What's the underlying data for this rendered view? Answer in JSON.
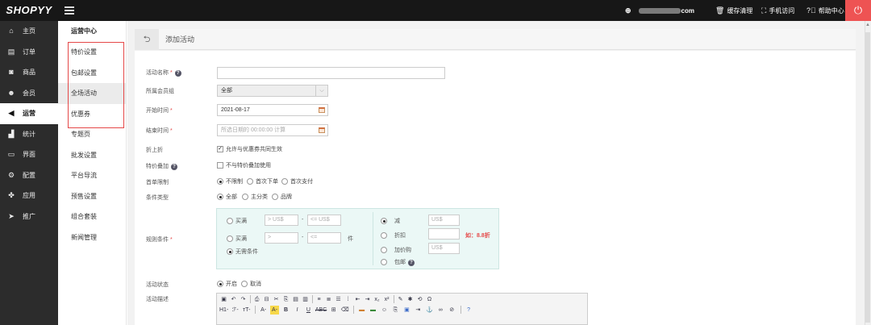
{
  "topbar": {
    "logo": "SHOPYY",
    "domain": "com",
    "cache_clear": "缓存清理",
    "mobile_visit": "手机访问",
    "help_center": "帮助中心",
    "icons": [
      "globe-icon",
      "trash-icon",
      "qr-icon",
      "help-icon",
      "power-icon"
    ]
  },
  "sidebar": {
    "items": [
      {
        "label": "主页",
        "icon": "home-icon"
      },
      {
        "label": "订单",
        "icon": "order-icon"
      },
      {
        "label": "商品",
        "icon": "box-icon"
      },
      {
        "label": "会员",
        "icon": "users-icon"
      },
      {
        "label": "运营",
        "icon": "megaphone-icon",
        "active": true
      },
      {
        "label": "统计",
        "icon": "chart-icon"
      },
      {
        "label": "界面",
        "icon": "window-icon"
      },
      {
        "label": "配置",
        "icon": "gear-icon"
      },
      {
        "label": "应用",
        "icon": "puzzle-icon"
      },
      {
        "label": "推广",
        "icon": "send-icon"
      }
    ]
  },
  "submenu": {
    "title": "运营中心",
    "items": [
      {
        "label": "特价设置"
      },
      {
        "label": "包邮设置"
      },
      {
        "label": "全场活动",
        "active": true
      },
      {
        "label": "优惠券"
      },
      {
        "label": "专题页"
      },
      {
        "label": "批发设置"
      },
      {
        "label": "平台导流"
      },
      {
        "label": "预售设置"
      },
      {
        "label": "组合套装"
      },
      {
        "label": "新闻管理"
      }
    ]
  },
  "page": {
    "title": "添加活动"
  },
  "form": {
    "name_label": "活动名称",
    "name_value": "",
    "member_group_label": "所属会员组",
    "member_group_value": "全部",
    "start_label": "开始时间",
    "start_value": "2021-08-17",
    "end_label": "结束时间",
    "end_placeholder": "所选日期的 00:00:00 计算",
    "discount_label": "折上折",
    "discount_option": "允许与优惠券共同生效",
    "special_label": "特价叠加",
    "special_option": "不与特价叠加使用",
    "first_label": "首单限制",
    "first_options": [
      "不限制",
      "首次下单",
      "首次支付"
    ],
    "cond_type_label": "条件类型",
    "cond_type_options": [
      "全部",
      "主分类",
      "品牌"
    ],
    "rule_label": "规则条件",
    "rule": {
      "buy_label_1": "买满",
      "min_placeholder_1": "> US$",
      "dash": "-",
      "max_placeholder_1": "<= US$",
      "buy_label_2": "买满",
      "min_placeholder_2": ">",
      "max_placeholder_2": "<=",
      "unit": "件",
      "no_cond": "无需条件",
      "reduce": "减",
      "reduce_placeholder": "US$",
      "discount": "折扣",
      "discount_hint": "如：8.8折",
      "add_price": "加价购",
      "add_price_placeholder": "US$",
      "free_ship": "包邮"
    },
    "status_label": "活动状态",
    "status_options": [
      "开启",
      "取消"
    ],
    "desc_label": "活动描述",
    "editor_row1": [
      "▣",
      "↶",
      "↷",
      "⎙",
      "⊟",
      "✂",
      "⎘",
      "▤",
      "▥",
      "≡",
      "≣",
      "☰",
      "⁞",
      "⇤",
      "⇥",
      "x₂",
      "x²",
      "✎",
      "✱",
      "⟲",
      "Ω"
    ],
    "editor_row2_text": [
      "H1-",
      "ℱ-",
      "ᴛT-",
      "A-",
      "A-",
      "B",
      "I",
      "U",
      "ABC"
    ]
  },
  "colors": {
    "topbar": "#171717",
    "sidebar": "#2c2c2c",
    "power": "#ee5353",
    "highlight_box": "#e54848",
    "rule_box": "#ebf8f6",
    "hint": "#e54848"
  }
}
